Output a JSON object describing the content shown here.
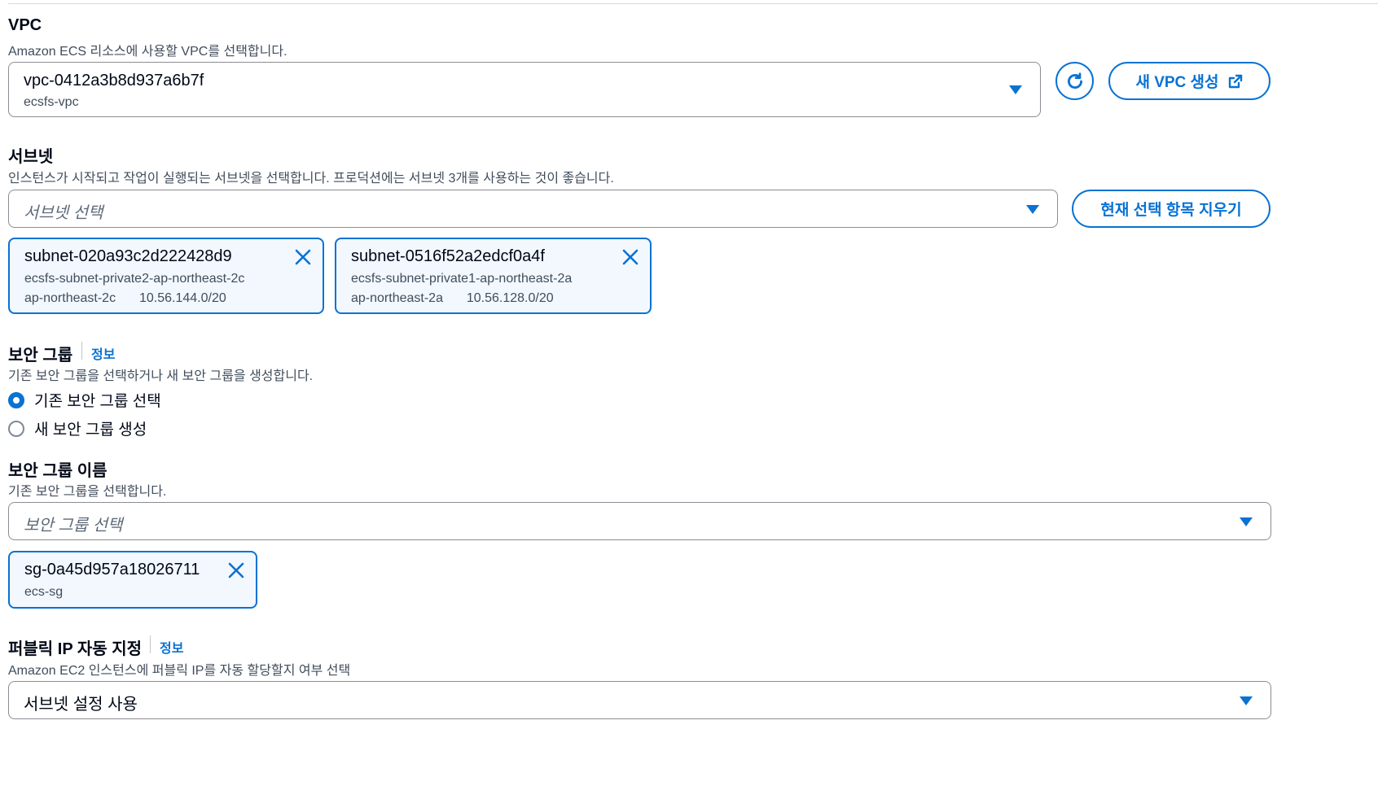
{
  "vpc": {
    "label": "VPC",
    "description": "Amazon ECS 리소스에 사용할 VPC를 선택합니다.",
    "selected_id": "vpc-0412a3b8d937a6b7f",
    "selected_name": "ecsfs-vpc",
    "refresh_icon": "refresh-icon",
    "create_button": "새 VPC 생성",
    "external_icon": "external-link-icon"
  },
  "subnets": {
    "label": "서브넷",
    "description": "인스턴스가 시작되고 작업이 실행되는 서브넷을 선택합니다. 프로덕션에는 서브넷 3개를 사용하는 것이 좋습니다.",
    "placeholder": "서브넷 선택",
    "clear_button": "현재 선택 항목 지우기",
    "tokens": [
      {
        "id": "subnet-020a93c2d222428d9",
        "name": "ecsfs-subnet-private2-ap-northeast-2c",
        "az": "ap-northeast-2c",
        "cidr": "10.56.144.0/20"
      },
      {
        "id": "subnet-0516f52a2edcf0a4f",
        "name": "ecsfs-subnet-private1-ap-northeast-2a",
        "az": "ap-northeast-2a",
        "cidr": "10.56.128.0/20"
      }
    ]
  },
  "security_group": {
    "label": "보안 그룹",
    "info": "정보",
    "description": "기존 보안 그룹을 선택하거나 새 보안 그룹을 생성합니다.",
    "options": [
      {
        "label": "기존 보안 그룹 선택",
        "checked": true
      },
      {
        "label": "새 보안 그룹 생성",
        "checked": false
      }
    ]
  },
  "security_group_name": {
    "label": "보안 그룹 이름",
    "description": "기존 보안 그룹을 선택합니다.",
    "placeholder": "보안 그룹 선택",
    "tokens": [
      {
        "id": "sg-0a45d957a18026711",
        "name": "ecs-sg"
      }
    ]
  },
  "public_ip": {
    "label": "퍼블릭 IP 자동 지정",
    "info": "정보",
    "description": "Amazon EC2 인스턴스에 퍼블릭 IP를 자동 할당할지 여부 선택",
    "selected": "서브넷 설정 사용"
  },
  "colors": {
    "accent": "#0972d3",
    "token_bg": "#f2f8fd",
    "text": "#000716",
    "secondary": "#414d5c"
  }
}
